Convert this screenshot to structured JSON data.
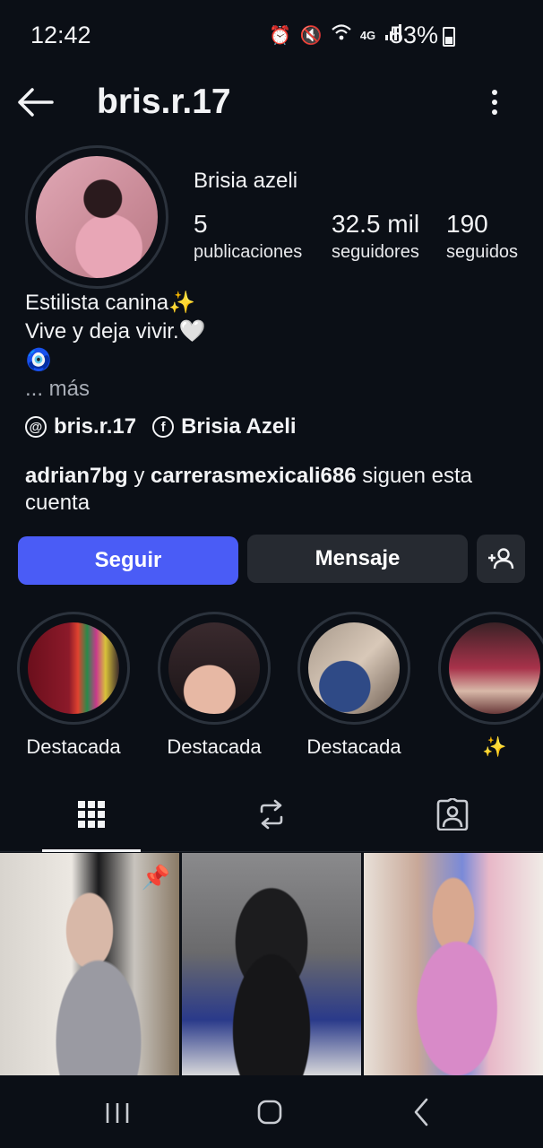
{
  "status_bar": {
    "time": "12:42",
    "network": "4G",
    "battery": "53%"
  },
  "header": {
    "username": "bris.r.17"
  },
  "profile": {
    "display_name": "Brisia azeli",
    "stats": [
      {
        "value": "5",
        "label": "publicaciones"
      },
      {
        "value": "32.5 mil",
        "label": "seguidores"
      },
      {
        "value": "190",
        "label": "seguidos"
      }
    ],
    "bio_line1": "Estilista canina✨",
    "bio_line2": "Vive y deja vivir.🤍",
    "bio_line3": "🧿",
    "bio_more": "... más",
    "threads_link": "bris.r.17",
    "facebook_link": "Brisia Azeli",
    "followed_by_user1": "adrian7bg",
    "followed_by_and": " y ",
    "followed_by_user2": "carrerasmexicali686",
    "followed_by_suffix": " siguen esta cuenta"
  },
  "actions": {
    "follow": "Seguir",
    "message": "Mensaje"
  },
  "highlights": [
    {
      "label": "Destacada"
    },
    {
      "label": "Destacada"
    },
    {
      "label": "Destacada"
    },
    {
      "label": "✨"
    }
  ],
  "colors": {
    "background": "#0b0f16",
    "follow_button": "#4a5cf6",
    "secondary_button": "#262a31"
  },
  "tabs": [
    {
      "icon": "grid-icon",
      "active": true
    },
    {
      "icon": "reels-repost-icon",
      "active": false
    },
    {
      "icon": "tagged-icon",
      "active": false
    }
  ]
}
